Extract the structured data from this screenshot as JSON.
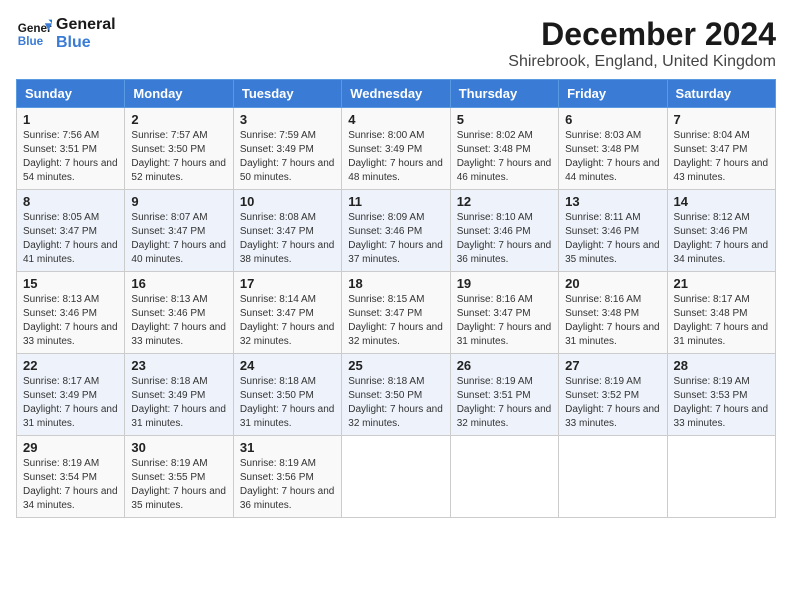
{
  "logo": {
    "line1": "General",
    "line2": "Blue"
  },
  "title": "December 2024",
  "subtitle": "Shirebrook, England, United Kingdom",
  "days_of_week": [
    "Sunday",
    "Monday",
    "Tuesday",
    "Wednesday",
    "Thursday",
    "Friday",
    "Saturday"
  ],
  "weeks": [
    [
      {
        "day": "1",
        "sunrise": "7:56 AM",
        "sunset": "3:51 PM",
        "daylight": "7 hours and 54 minutes."
      },
      {
        "day": "2",
        "sunrise": "7:57 AM",
        "sunset": "3:50 PM",
        "daylight": "7 hours and 52 minutes."
      },
      {
        "day": "3",
        "sunrise": "7:59 AM",
        "sunset": "3:49 PM",
        "daylight": "7 hours and 50 minutes."
      },
      {
        "day": "4",
        "sunrise": "8:00 AM",
        "sunset": "3:49 PM",
        "daylight": "7 hours and 48 minutes."
      },
      {
        "day": "5",
        "sunrise": "8:02 AM",
        "sunset": "3:48 PM",
        "daylight": "7 hours and 46 minutes."
      },
      {
        "day": "6",
        "sunrise": "8:03 AM",
        "sunset": "3:48 PM",
        "daylight": "7 hours and 44 minutes."
      },
      {
        "day": "7",
        "sunrise": "8:04 AM",
        "sunset": "3:47 PM",
        "daylight": "7 hours and 43 minutes."
      }
    ],
    [
      {
        "day": "8",
        "sunrise": "8:05 AM",
        "sunset": "3:47 PM",
        "daylight": "7 hours and 41 minutes."
      },
      {
        "day": "9",
        "sunrise": "8:07 AM",
        "sunset": "3:47 PM",
        "daylight": "7 hours and 40 minutes."
      },
      {
        "day": "10",
        "sunrise": "8:08 AM",
        "sunset": "3:47 PM",
        "daylight": "7 hours and 38 minutes."
      },
      {
        "day": "11",
        "sunrise": "8:09 AM",
        "sunset": "3:46 PM",
        "daylight": "7 hours and 37 minutes."
      },
      {
        "day": "12",
        "sunrise": "8:10 AM",
        "sunset": "3:46 PM",
        "daylight": "7 hours and 36 minutes."
      },
      {
        "day": "13",
        "sunrise": "8:11 AM",
        "sunset": "3:46 PM",
        "daylight": "7 hours and 35 minutes."
      },
      {
        "day": "14",
        "sunrise": "8:12 AM",
        "sunset": "3:46 PM",
        "daylight": "7 hours and 34 minutes."
      }
    ],
    [
      {
        "day": "15",
        "sunrise": "8:13 AM",
        "sunset": "3:46 PM",
        "daylight": "7 hours and 33 minutes."
      },
      {
        "day": "16",
        "sunrise": "8:13 AM",
        "sunset": "3:46 PM",
        "daylight": "7 hours and 33 minutes."
      },
      {
        "day": "17",
        "sunrise": "8:14 AM",
        "sunset": "3:47 PM",
        "daylight": "7 hours and 32 minutes."
      },
      {
        "day": "18",
        "sunrise": "8:15 AM",
        "sunset": "3:47 PM",
        "daylight": "7 hours and 32 minutes."
      },
      {
        "day": "19",
        "sunrise": "8:16 AM",
        "sunset": "3:47 PM",
        "daylight": "7 hours and 31 minutes."
      },
      {
        "day": "20",
        "sunrise": "8:16 AM",
        "sunset": "3:48 PM",
        "daylight": "7 hours and 31 minutes."
      },
      {
        "day": "21",
        "sunrise": "8:17 AM",
        "sunset": "3:48 PM",
        "daylight": "7 hours and 31 minutes."
      }
    ],
    [
      {
        "day": "22",
        "sunrise": "8:17 AM",
        "sunset": "3:49 PM",
        "daylight": "7 hours and 31 minutes."
      },
      {
        "day": "23",
        "sunrise": "8:18 AM",
        "sunset": "3:49 PM",
        "daylight": "7 hours and 31 minutes."
      },
      {
        "day": "24",
        "sunrise": "8:18 AM",
        "sunset": "3:50 PM",
        "daylight": "7 hours and 31 minutes."
      },
      {
        "day": "25",
        "sunrise": "8:18 AM",
        "sunset": "3:50 PM",
        "daylight": "7 hours and 32 minutes."
      },
      {
        "day": "26",
        "sunrise": "8:19 AM",
        "sunset": "3:51 PM",
        "daylight": "7 hours and 32 minutes."
      },
      {
        "day": "27",
        "sunrise": "8:19 AM",
        "sunset": "3:52 PM",
        "daylight": "7 hours and 33 minutes."
      },
      {
        "day": "28",
        "sunrise": "8:19 AM",
        "sunset": "3:53 PM",
        "daylight": "7 hours and 33 minutes."
      }
    ],
    [
      {
        "day": "29",
        "sunrise": "8:19 AM",
        "sunset": "3:54 PM",
        "daylight": "7 hours and 34 minutes."
      },
      {
        "day": "30",
        "sunrise": "8:19 AM",
        "sunset": "3:55 PM",
        "daylight": "7 hours and 35 minutes."
      },
      {
        "day": "31",
        "sunrise": "8:19 AM",
        "sunset": "3:56 PM",
        "daylight": "7 hours and 36 minutes."
      },
      null,
      null,
      null,
      null
    ]
  ]
}
